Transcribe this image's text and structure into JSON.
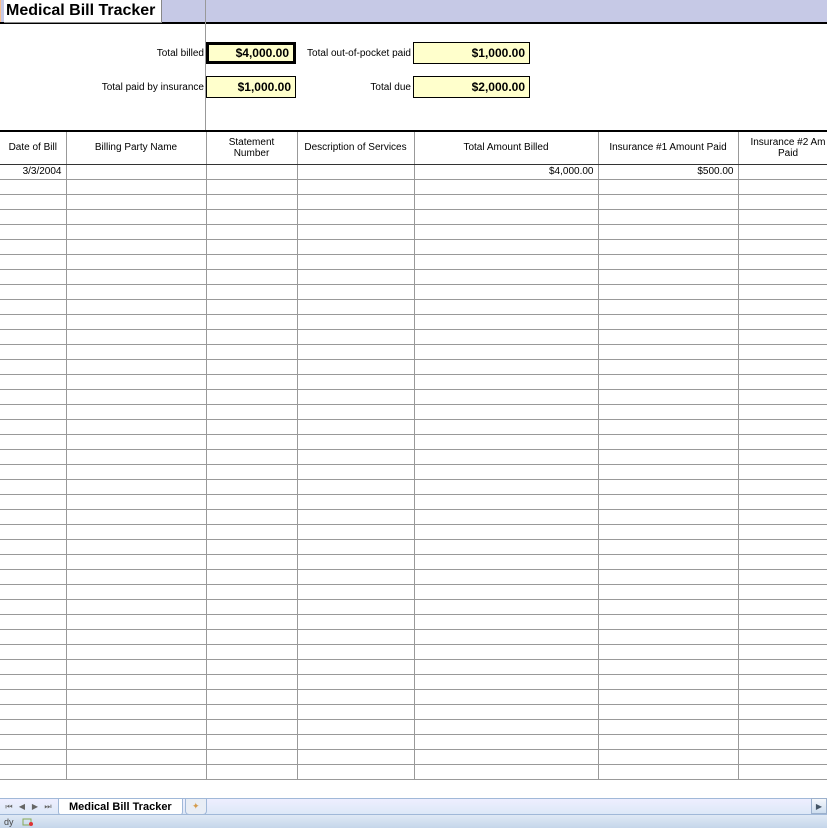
{
  "title": "Medical Bill Tracker",
  "summary": {
    "billed_label": "Total billed",
    "billed_value": "$4,000.00",
    "oop_label": "Total out-of-pocket paid",
    "oop_value": "$1,000.00",
    "insurance_label": "Total paid by insurance",
    "insurance_value": "$1,000.00",
    "due_label": "Total due",
    "due_value": "$2,000.00"
  },
  "columns": {
    "date": "Date of Bill",
    "party": "Billing Party Name",
    "stmt": "Statement Number",
    "desc": "Description of Services",
    "total": "Total Amount Billed",
    "ins1": "Insurance #1 Amount Paid",
    "ins2": "Insurance #2 Am Paid"
  },
  "rows": [
    {
      "date": "3/3/2004",
      "party": "",
      "stmt": "",
      "desc": "",
      "total": "$4,000.00",
      "ins1": "$500.00",
      "ins2": "$"
    }
  ],
  "empty_row_count": 40,
  "footer": {
    "sheet_tab": "Medical Bill Tracker",
    "status": "dy"
  }
}
